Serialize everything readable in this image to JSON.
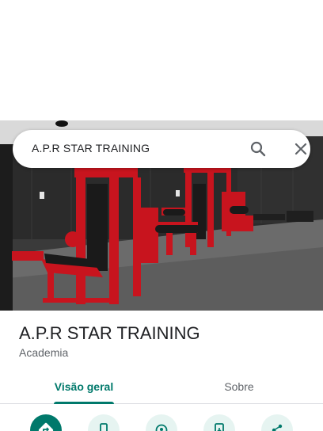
{
  "search": {
    "query": "A.P.R STAR TRAINING"
  },
  "place": {
    "title": "A.P.R STAR TRAINING",
    "category": "Academia"
  },
  "tabs": [
    {
      "label": "Visão geral",
      "active": true
    },
    {
      "label": "Sobre",
      "active": false
    }
  ],
  "actions": [
    {
      "icon": "directions-icon",
      "primary": true
    },
    {
      "icon": "phone-icon",
      "primary": false
    },
    {
      "icon": "save-icon",
      "primary": false
    },
    {
      "icon": "add-to-phone-icon",
      "primary": false
    },
    {
      "icon": "share-icon",
      "primary": false
    }
  ],
  "colors": {
    "accent": "#00796b",
    "action_bg": "#e6f4f1",
    "equipment_red": "#c8141e"
  }
}
